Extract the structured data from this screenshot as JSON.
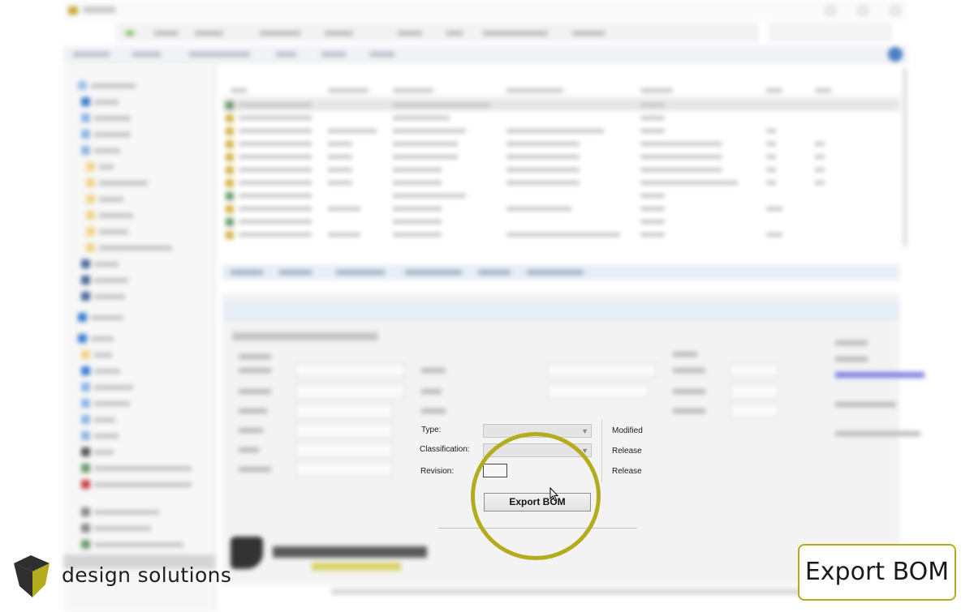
{
  "form": {
    "type_label": "Type:",
    "classification_label": "Classification:",
    "revision_label": "Revision:",
    "modified_label": "Modified",
    "released_label_1": "Release",
    "released_label_2": "Release",
    "revision_value": "",
    "export_button_label": "Export BOM"
  },
  "branding": {
    "company_name": "design solutions"
  },
  "caption": {
    "text": "Export BOM"
  },
  "colors": {
    "highlight": "#b3ac1e",
    "logo_dark": "#2f2f2f",
    "logo_accent": "#b3ac1e"
  }
}
